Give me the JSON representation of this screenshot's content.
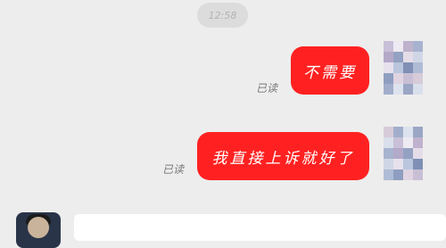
{
  "chat": {
    "timestamp": "12:58",
    "messages": [
      {
        "text": "不需要",
        "status": "已读"
      },
      {
        "text": "我直接上诉就好了",
        "status": "已读"
      }
    ]
  },
  "colors": {
    "bubble": "#ff2121",
    "background": "#ededed"
  },
  "icons": {
    "contact_avatar": "blurred-avatar-icon",
    "self_avatar": "user-avatar-icon"
  }
}
